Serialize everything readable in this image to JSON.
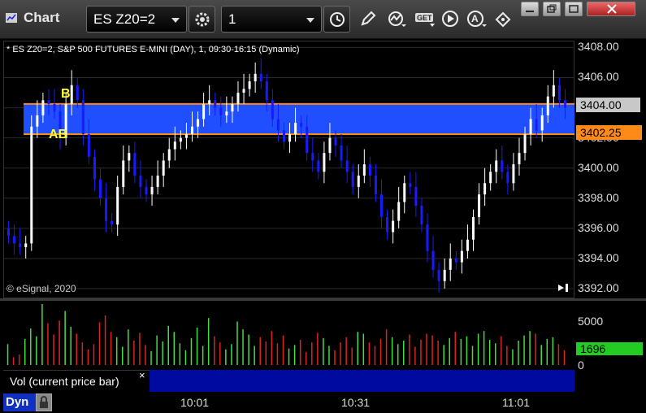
{
  "window": {
    "title": "Chart",
    "symbol": "ES Z20=2",
    "interval": "1"
  },
  "chart": {
    "description": "* ES Z20=2, S&P 500 FUTURES E-MINI (DAY), 1, 09:30-16:15 (Dynamic)",
    "copyright": "© eSignal, 2020",
    "markers": {
      "b": "B",
      "ab": "AB"
    },
    "last_price_label": "3404.00",
    "level_label": "3402.25",
    "vol_current_label": "1696",
    "vol_study_label": "Vol (current price bar)",
    "dyn_label": "Dyn",
    "close_glyph": "×"
  },
  "chart_data": {
    "type": "candlestick",
    "y_ticks": [
      "3408.00",
      "3406.00",
      "3404.00",
      "3402.00",
      "3400.00",
      "3398.00",
      "3396.00",
      "3394.00",
      "3392.00"
    ],
    "y_tick_values": [
      3408,
      3406,
      3404,
      3402,
      3400,
      3398,
      3396,
      3394,
      3392
    ],
    "ylim": [
      3391.3,
      3408.4
    ],
    "x_ticks": [
      "10:01",
      "10:31",
      "11:01"
    ],
    "band": {
      "high": 3404.25,
      "low": 3402.25
    },
    "close_series": [
      3395.5,
      3395,
      3394.75,
      3395,
      3402.75,
      3403.5,
      3404.5,
      3404.25,
      3403.75,
      3402,
      3404.25,
      3405.5,
      3404.5,
      3402.25,
      3400.75,
      3399.25,
      3398,
      3396.5,
      3396.25,
      3398.75,
      3400.5,
      3401,
      3399.5,
      3398.75,
      3398.25,
      3398.75,
      3399.5,
      3400.5,
      3401.25,
      3401.75,
      3402,
      3402.25,
      3402.75,
      3403.25,
      3404.25,
      3404.5,
      3404,
      3403.5,
      3403.75,
      3404.25,
      3405,
      3405.25,
      3405.75,
      3406.25,
      3405.75,
      3404.5,
      3403.25,
      3402.5,
      3401.75,
      3402.25,
      3403,
      3402.75,
      3401,
      3400.5,
      3399.75,
      3401,
      3402,
      3401.5,
      3400.5,
      3399.75,
      3398.75,
      3399.5,
      3400.25,
      3399.5,
      3398.25,
      3396.75,
      3395.75,
      3396.5,
      3397.75,
      3399,
      3398.75,
      3397.5,
      3396.25,
      3394.5,
      3393.25,
      3392.5,
      3393.25,
      3394,
      3393.75,
      3394.5,
      3395.25,
      3396.75,
      3398.25,
      3399,
      3399.75,
      3400.5,
      3399.75,
      3399,
      3400.25,
      3401,
      3402.25,
      3403.25,
      3402.5,
      3403.5,
      3404.75,
      3405.5,
      3404.5,
      3404
    ],
    "volume_ylim": [
      0,
      7000
    ],
    "volume_ticks": [
      5000,
      0
    ],
    "volume_values": [
      2400,
      900,
      1200,
      3000,
      4200,
      3300,
      7000,
      4800,
      3500,
      5100,
      6200,
      4400,
      3600,
      2600,
      1800,
      2400,
      4900,
      5700,
      3800,
      3200,
      2100,
      4100,
      2800,
      3700,
      2300,
      1600,
      3400,
      2700,
      4500,
      3800,
      2500,
      1700,
      3100,
      4300,
      2200,
      5400,
      3300,
      2600,
      1800,
      2400,
      5000,
      4100,
      3500,
      2200,
      3200,
      2700,
      3900,
      2500,
      3400,
      1900,
      2300,
      2900,
      1500,
      2600,
      3700,
      3100,
      2200,
      1700,
      2600,
      3200,
      2000,
      3800,
      3600,
      2600,
      2200,
      3000,
      4100,
      3200,
      2400,
      2800,
      3500,
      2100,
      2900,
      3600,
      3400,
      2800,
      2300,
      3100,
      3800,
      3000,
      3300,
      2200,
      3600,
      3900,
      2900,
      2500,
      3300,
      2200,
      1800,
      2800,
      3400,
      3900,
      3600,
      2300,
      3000,
      3200,
      2400,
      1700
    ],
    "volume_current": 1696
  },
  "colors": {
    "up": "#ffffff",
    "down": "#1a1aff",
    "band": "#1f4fff",
    "band_line": "#ff8a1a",
    "vol_up": "#44dd44",
    "vol_down": "#dd2222"
  }
}
